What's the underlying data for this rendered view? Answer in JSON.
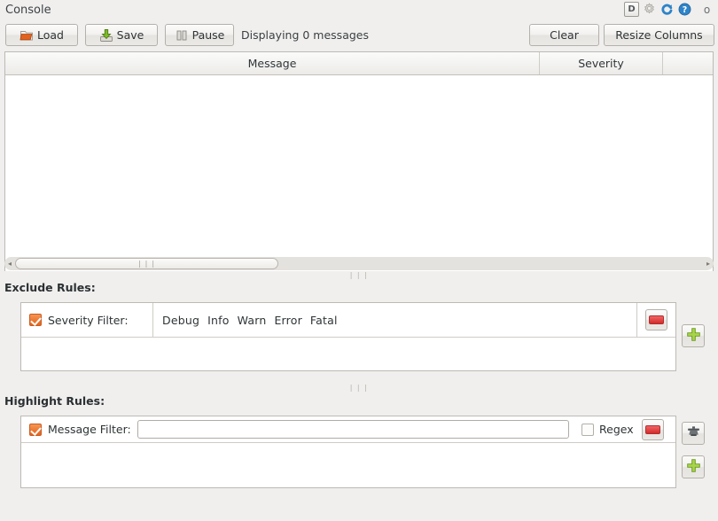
{
  "window": {
    "title": "Console",
    "title_icons": [
      {
        "name": "detach-icon",
        "label": "D"
      },
      {
        "name": "settings-gear-icon",
        "label": ""
      },
      {
        "name": "refresh-icon",
        "label": ""
      },
      {
        "name": "help-icon",
        "label": "?"
      },
      {
        "name": "close-icon",
        "label": "o"
      }
    ]
  },
  "toolbar": {
    "load_label": "Load",
    "save_label": "Save",
    "pause_label": "Pause",
    "status": "Displaying 0 messages",
    "clear_label": "Clear",
    "resize_columns_label": "Resize Columns"
  },
  "message_table": {
    "columns": [
      {
        "key": "message",
        "label": "Message"
      },
      {
        "key": "severity",
        "label": "Severity"
      },
      {
        "key": "blank",
        "label": ""
      }
    ],
    "rows": []
  },
  "scrollbar": {
    "left_arrow": "◂",
    "right_arrow": "▸",
    "grip": "❘❘❘"
  },
  "splitter": {
    "grip": "❘❘❘"
  },
  "exclude_rules": {
    "heading": "Exclude Rules:",
    "rows": [
      {
        "enabled": true,
        "label": "Severity Filter:",
        "severities": [
          "Debug",
          "Info",
          "Warn",
          "Error",
          "Fatal"
        ],
        "remove_title": "Remove rule"
      }
    ],
    "add_title": "Add exclude rule"
  },
  "highlight_rules": {
    "heading": "Highlight Rules:",
    "rows": [
      {
        "enabled": true,
        "label": "Message Filter:",
        "value": "",
        "placeholder": "",
        "regex_label": "Regex",
        "regex_checked": false,
        "remove_title": "Remove rule"
      }
    ],
    "color_title": "Choose highlight color",
    "add_title": "Add highlight rule"
  },
  "colors": {
    "background": "#f0efee",
    "panel": "#ffffff",
    "accent_orange": "#e4641d",
    "remove_red": "#d32b2b",
    "add_green": "#8cc63f",
    "border": "#bdbab4"
  }
}
